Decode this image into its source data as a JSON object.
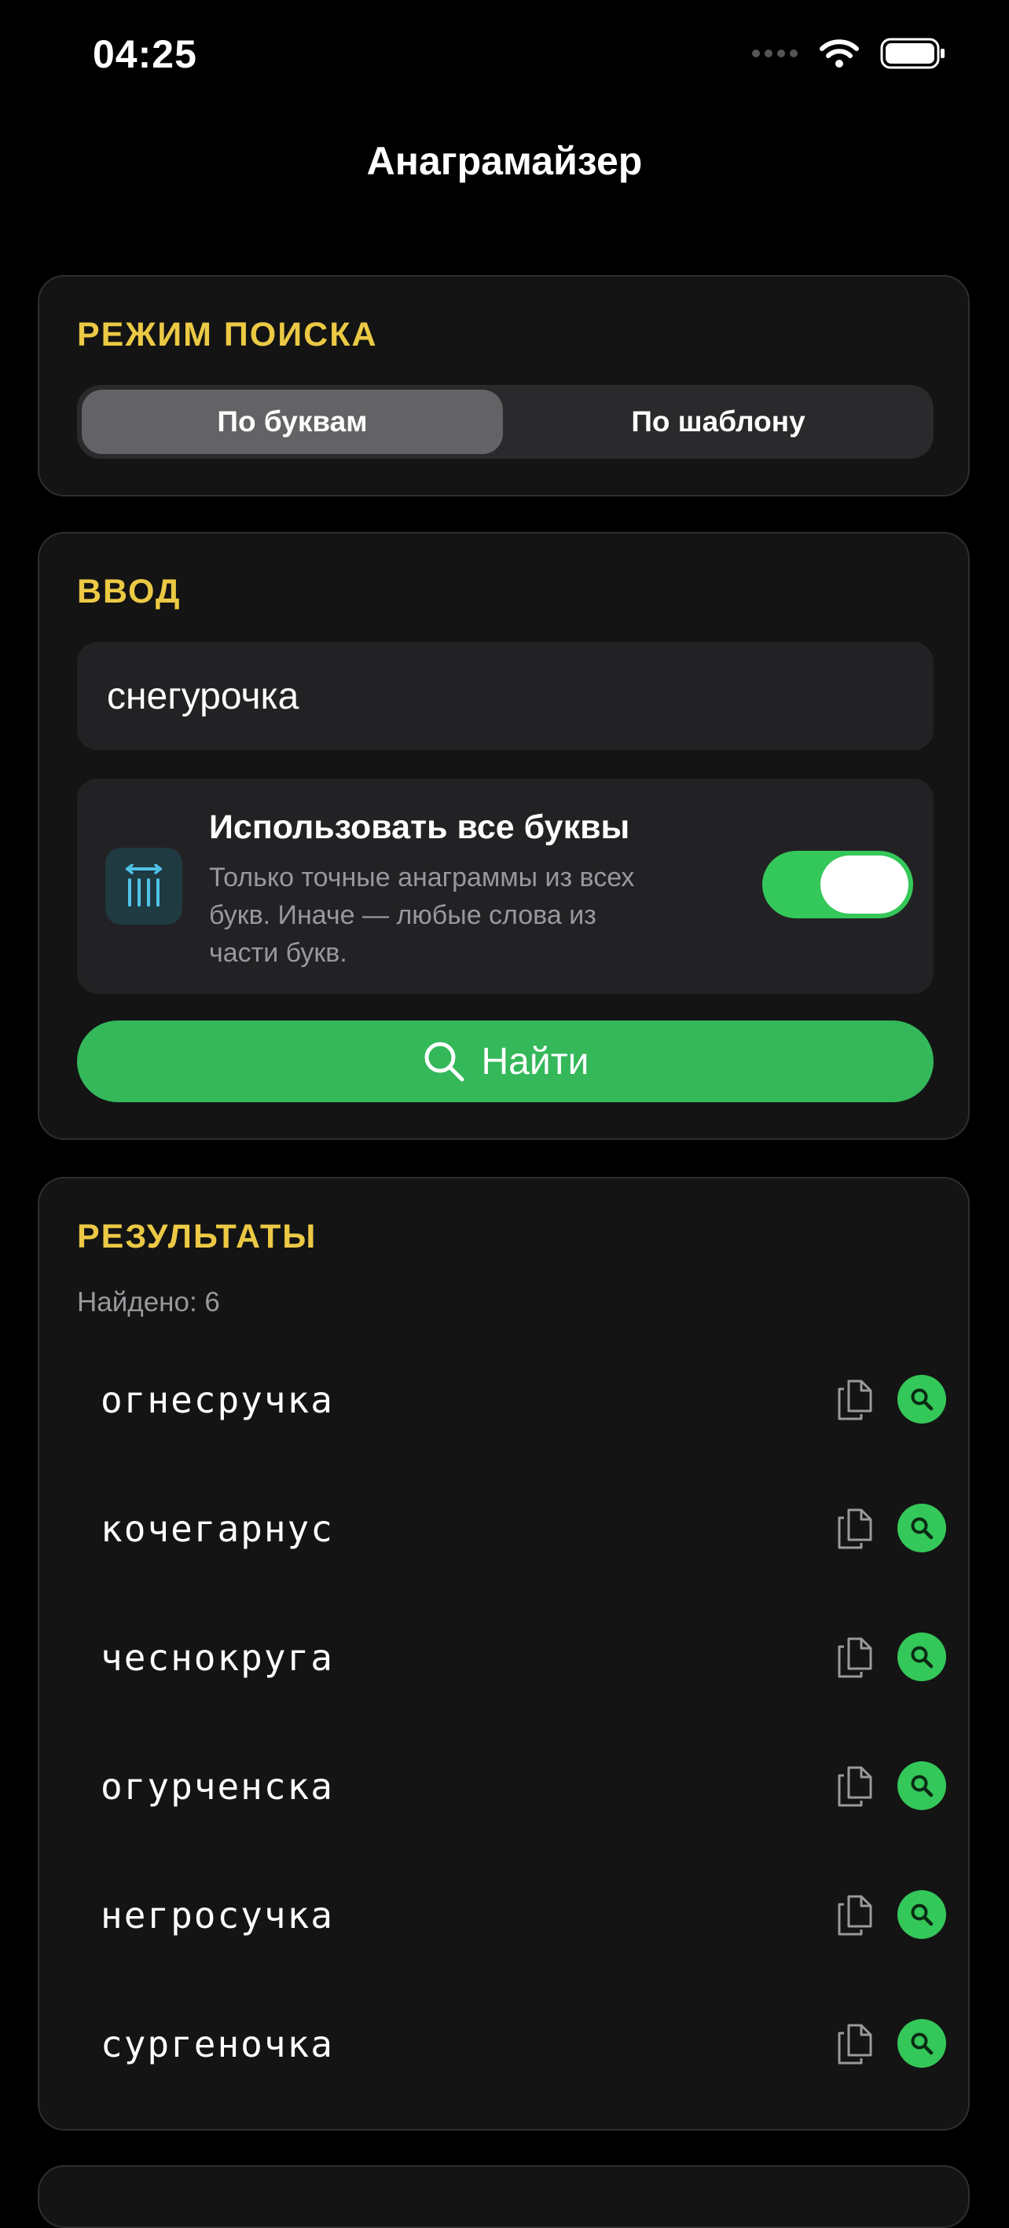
{
  "status_bar": {
    "time": "04:25"
  },
  "nav": {
    "title": "Анаграмайзер"
  },
  "mode": {
    "section_title": "РЕЖИМ ПОИСКА",
    "options": [
      "По буквам",
      "По шаблону"
    ],
    "selected": "По буквам"
  },
  "input": {
    "section_title": "ВВОД",
    "value": "снегурочка",
    "use_all_letters": {
      "title": "Использовать все буквы",
      "description": "Только точные анаграммы из всех букв. Иначе — любые слова из части букв.",
      "enabled": true
    },
    "search_button_label": "Найти"
  },
  "results": {
    "section_title": "РЕЗУЛЬТАТЫ",
    "found_text": "Найдено: 6",
    "items": [
      "огнесручка",
      "кочегарнус",
      "чеснокруга",
      "огурченска",
      "негросучка",
      "сургеночка"
    ]
  },
  "icons": {
    "copy": "copy-icon",
    "search": "search-icon",
    "letters": "letters-icon"
  },
  "colors": {
    "accent_yellow": "#ecc944",
    "accent_green": "#34c759",
    "card_bg": "#141414"
  }
}
